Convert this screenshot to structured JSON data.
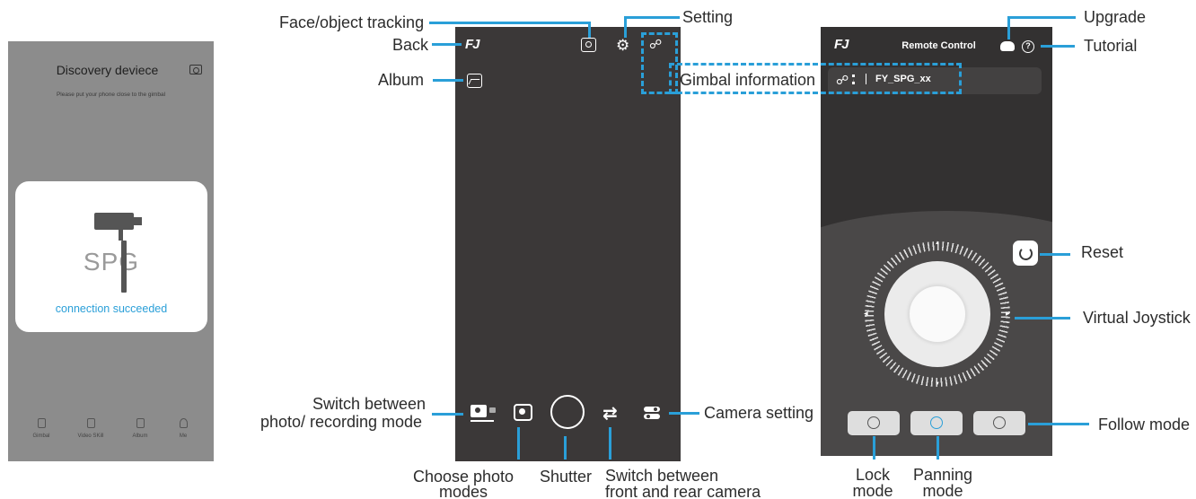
{
  "discovery_screen": {
    "title": "Discovery deviece",
    "subtitle": "Please put your phone close to the gimbal",
    "card_product": "SPG",
    "card_status": "connection succeeded",
    "nav": [
      "Gimbal",
      "Video SKill",
      "Album",
      "Me"
    ]
  },
  "camera_screen": {
    "logo": "FJ",
    "icons": [
      "back-icon",
      "face-tracking-icon",
      "setting-icon",
      "gimbal-info-icon",
      "album-icon",
      "photo-record-switch-icon",
      "photo-mode-icon",
      "shutter-button",
      "flip-camera-icon",
      "camera-setting-icon"
    ]
  },
  "remote_screen": {
    "logo": "FJ",
    "title": "Remote Control",
    "device_name": "FY_SPG_xx",
    "help_symbol": "?",
    "modes": [
      "lock",
      "panning",
      "follow"
    ]
  },
  "callouts": {
    "face_tracking": "Face/object tracking",
    "setting": "Setting",
    "back": "Back",
    "album": "Album",
    "gimbal_info": "Gimbal information",
    "switch_mode_line1": "Switch between",
    "switch_mode_line2": "photo/ recording mode",
    "camera_setting": "Camera setting",
    "choose_photo_line1": "Choose photo",
    "choose_photo_line2": "modes",
    "shutter": "Shutter",
    "switch_camera_line1": "Switch between",
    "switch_camera_line2": "front and rear camera",
    "upgrade": "Upgrade",
    "tutorial": "Tutorial",
    "reset": "Reset",
    "virtual_joystick": "Virtual Joystick",
    "follow_mode": "Follow mode",
    "lock_line1": "Lock",
    "lock_line2": "mode",
    "panning_line1": "Panning",
    "panning_line2": "mode"
  },
  "colors": {
    "accent": "#2a9fd8",
    "phone_dark": "#3b3838",
    "discovery_bg": "#8c8c8c"
  }
}
